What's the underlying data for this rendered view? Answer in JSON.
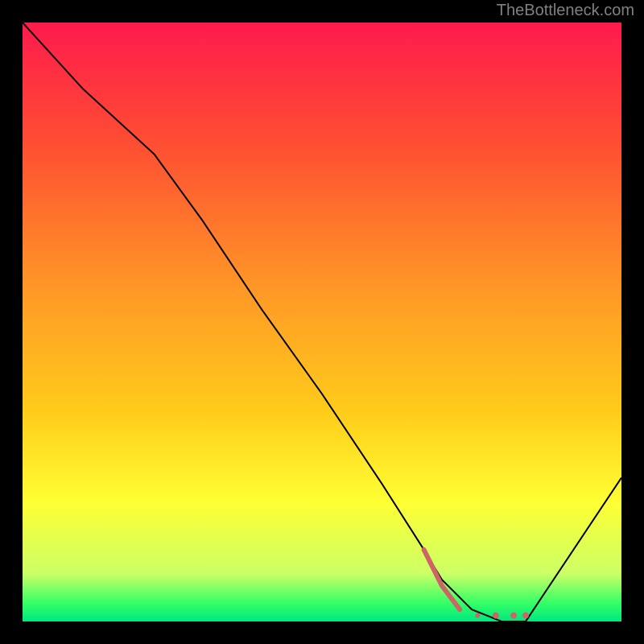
{
  "watermark": "TheBottleneck.com",
  "chart_data": {
    "type": "line",
    "title": "",
    "xlabel": "",
    "ylabel": "",
    "xlim": [
      0,
      100
    ],
    "ylim": [
      0,
      100
    ],
    "grid": false,
    "legend": false,
    "background_gradient": {
      "stops": [
        {
          "offset": 0.0,
          "color": "#ff1a4d"
        },
        {
          "offset": 0.2,
          "color": "#ff4d33"
        },
        {
          "offset": 0.45,
          "color": "#ff9926"
        },
        {
          "offset": 0.65,
          "color": "#ffcc1a"
        },
        {
          "offset": 0.8,
          "color": "#ffff33"
        },
        {
          "offset": 0.92,
          "color": "#ccff66"
        },
        {
          "offset": 0.97,
          "color": "#33ff66"
        },
        {
          "offset": 1.0,
          "color": "#00e680"
        }
      ]
    },
    "series": [
      {
        "name": "bottleneck-curve",
        "x": [
          0,
          10,
          22,
          30,
          40,
          50,
          60,
          67,
          70,
          75,
          80,
          84,
          100
        ],
        "values": [
          100,
          89,
          78,
          67,
          52,
          38,
          23,
          12,
          7,
          2,
          0,
          0,
          24
        ]
      },
      {
        "name": "highlighted-range",
        "x": [
          67,
          70,
          73,
          76,
          79,
          82,
          84
        ],
        "values": [
          12,
          6,
          2,
          1,
          1,
          1,
          1
        ]
      }
    ]
  }
}
